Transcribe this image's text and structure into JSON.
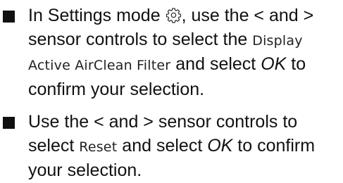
{
  "instructions": {
    "step1": {
      "part1": "In Settings mode",
      "icon": "settings-gear-icon",
      "part2": ", use the < and > sensor controls to select the",
      "display_text": "Display Active AirClean Filter",
      "part3": "and select",
      "ok": "OK",
      "part4": "to confirm your selection."
    },
    "step2": {
      "part1": "Use the < and > sensor controls to select",
      "display_text": "Reset",
      "part2": "and select",
      "ok": "OK",
      "part3": "to confirm your selection."
    }
  }
}
